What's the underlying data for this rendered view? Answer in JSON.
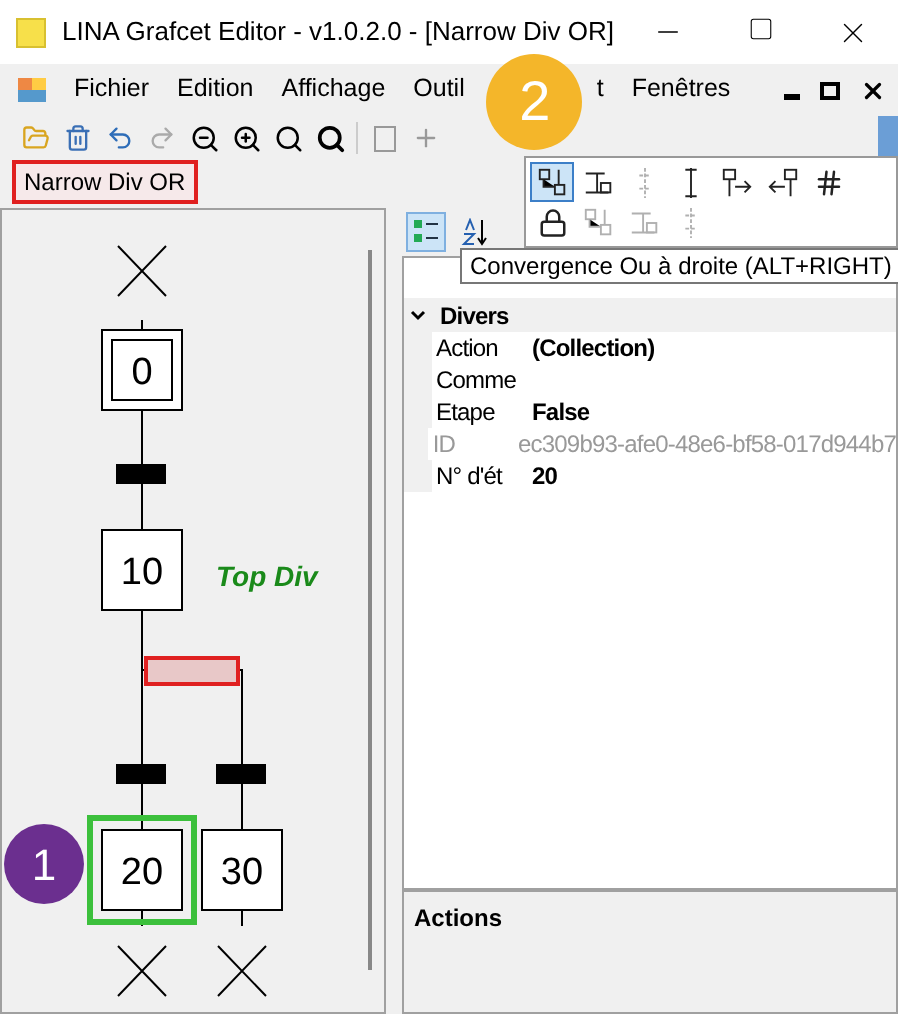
{
  "window": {
    "title": "LINA Grafcet Editor - v1.0.2.0 - [Narrow Div OR]"
  },
  "menu": [
    {
      "label": "Fichier"
    },
    {
      "label": "Edition"
    },
    {
      "label": "Affichage"
    },
    {
      "label": "Outil"
    },
    {
      "label": "t"
    },
    {
      "label": "Fenêtres"
    }
  ],
  "document_tab": {
    "label": "Narrow Div OR"
  },
  "popup_tools": [
    {
      "selected": true,
      "disabled": false
    },
    {
      "selected": false,
      "disabled": false
    },
    {
      "selected": false,
      "disabled": true
    },
    {
      "selected": false,
      "disabled": false
    },
    {
      "selected": false,
      "disabled": false
    },
    {
      "selected": false,
      "disabled": false
    },
    {
      "selected": false,
      "disabled": false
    },
    {
      "selected": false,
      "disabled": false
    },
    {
      "selected": false,
      "disabled": true
    },
    {
      "selected": false,
      "disabled": true
    },
    {
      "selected": false,
      "disabled": true
    }
  ],
  "tooltip": "Convergence Ou à droite (ALT+RIGHT)",
  "diagram": {
    "steps": [
      {
        "number": "0",
        "kind": "initial",
        "selected": false
      },
      {
        "number": "10",
        "kind": "normal",
        "selected": false
      },
      {
        "number": "20",
        "kind": "normal",
        "selected": true
      },
      {
        "number": "30",
        "kind": "normal",
        "selected": false
      }
    ],
    "comment": "Top Div",
    "divergence_selected": true
  },
  "properties": {
    "sort_categorized": true,
    "category": "Divers",
    "rows": [
      {
        "name": "Action",
        "value": "(Collection)",
        "disabled": false
      },
      {
        "name": "Comme",
        "disabled": false
      },
      {
        "name": "Etape",
        "value": "False",
        "disabled": false
      },
      {
        "name": "ID",
        "value": "ec309b93-afe0-48e6-bf58-017d944b7",
        "disabled": true
      },
      {
        "name": "N° d'ét",
        "value": "20",
        "disabled": false
      }
    ]
  },
  "actions_panel": {
    "title": "Actions"
  },
  "annotations": [
    {
      "label": "1",
      "color": "#6b2f8f"
    },
    {
      "label": "2",
      "color": "#f4b62a"
    }
  ]
}
